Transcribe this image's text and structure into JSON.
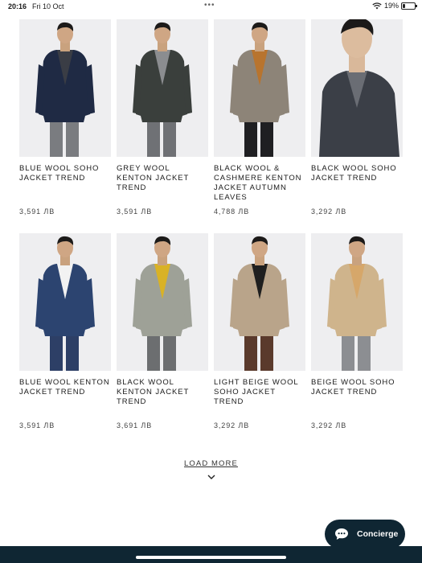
{
  "status_bar": {
    "time": "20:16",
    "date": "Fri 10 Oct",
    "battery": "19%",
    "battery_level": 0.19
  },
  "products": [
    {
      "name": "BLUE WOOL SOHO JACKET TREND",
      "price": "3,591 ЛВ",
      "jacket_color": "#1f2a44",
      "inner_color": "#3a3d45",
      "trouser_color": "#7a7c80"
    },
    {
      "name": "GREY WOOL KENTON JACKET TREND",
      "price": "3,591 ЛВ",
      "jacket_color": "#3a3f3c",
      "inner_color": "#8b8d90",
      "trouser_color": "#6f7175"
    },
    {
      "name": "BLACK WOOL & CASHMERE KENTON JACKET AUTUMN LEAVES",
      "price": "4,788 ЛВ",
      "jacket_color": "#8d8478",
      "inner_color": "#b8742e",
      "trouser_color": "#1f1f22"
    },
    {
      "name": "BLACK WOOL SOHO JACKET TREND",
      "price": "3,292 ЛВ",
      "jacket_color": "#3b3f47",
      "inner_color": "#6a6d74",
      "trouser_color": "#3b3f47"
    },
    {
      "name": "BLUE WOOL KENTON JACKET TREND",
      "price": "3,591 ЛВ",
      "jacket_color": "#2c4470",
      "inner_color": "#f2f2f2",
      "trouser_color": "#2d3f66"
    },
    {
      "name": "BLACK WOOL KENTON JACKET TREND",
      "price": "3,691 ЛВ",
      "jacket_color": "#9ea197",
      "inner_color": "#d9b226",
      "trouser_color": "#6c6e70"
    },
    {
      "name": "LIGHT BEIGE WOOL SOHO JACKET TREND",
      "price": "3,292 ЛВ",
      "jacket_color": "#b9a48a",
      "inner_color": "#1f1f1f",
      "trouser_color": "#5a3a2c"
    },
    {
      "name": "BEIGE WOOL SOHO JACKET TREND",
      "price": "3,292 ЛВ",
      "jacket_color": "#cfb48c",
      "inner_color": "#d6a76a",
      "trouser_color": "#8c8e92"
    }
  ],
  "load_more": {
    "label": "LOAD MORE",
    "icon": "chevron-down-icon"
  },
  "concierge": {
    "label": "Concierge",
    "icon": "chat-bubble-icon"
  },
  "colors": {
    "brand_dark": "#0f2633",
    "image_bg": "#eeeef0"
  }
}
